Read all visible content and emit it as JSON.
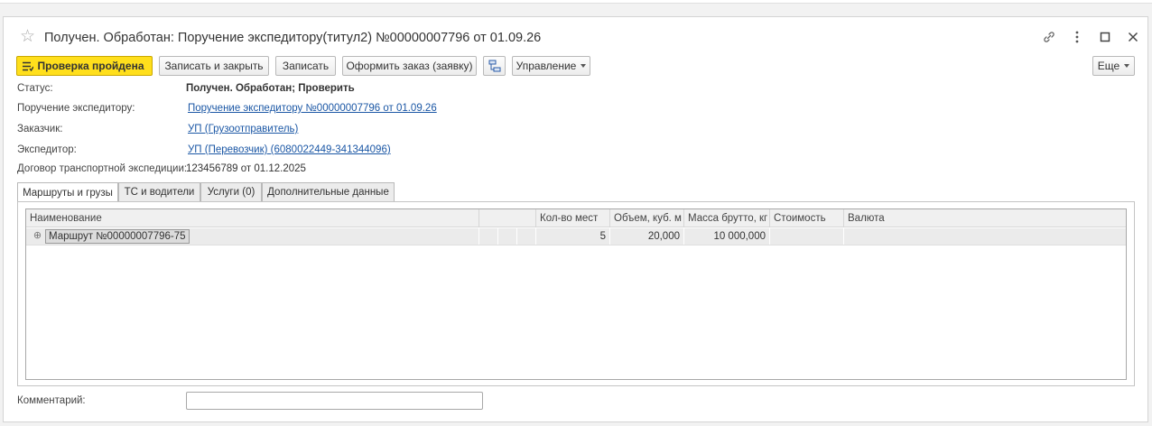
{
  "window": {
    "title": "Получен. Обработан: Поручение экспедитору(титул2) №00000007796 от 01.09.26"
  },
  "toolbar": {
    "check_passed": "Проверка пройдена",
    "save_close": "Записать и закрыть",
    "save": "Записать",
    "make_order": "Оформить заказ (заявку)",
    "management": "Управление",
    "more": "Еще"
  },
  "fields": {
    "status_label": "Статус:",
    "status_value": "Получен. Обработан; Проверить",
    "order_label": "Поручение экспедитору:",
    "order_value": "Поручение экспедитору №00000007796 от 01.09.26",
    "customer_label": "Заказчик:",
    "customer_value": "УП (Грузоотправитель)",
    "forwarder_label": "Экспедитор:",
    "forwarder_value": "УП (Перевозчик) (6080022449-341344096)",
    "contract_label": "Договор транспортной экспедиции:",
    "contract_value": "123456789 от 01.12.2025",
    "comment_label": "Комментарий:",
    "comment_value": ""
  },
  "tabs": [
    {
      "label": "Маршруты и грузы"
    },
    {
      "label": "ТС и водители"
    },
    {
      "label": "Услуги (0)"
    },
    {
      "label": "Дополнительные данные"
    }
  ],
  "grid": {
    "columns": [
      "Наименование",
      "",
      "Кол-во мест",
      "Объем, куб. м",
      "Масса брутто, кг",
      "Стоимость",
      "Валюта"
    ],
    "rows": [
      {
        "name": "Маршрут №00000007796-75",
        "places": "5",
        "volume": "20,000",
        "weight": "10 000,000",
        "cost": "",
        "currency": ""
      }
    ]
  },
  "icons": {
    "star": "star-icon",
    "link": "link-icon",
    "menu": "more-vertical-icon",
    "maximize": "maximize-icon",
    "close": "close-icon",
    "structure": "structure-icon"
  }
}
